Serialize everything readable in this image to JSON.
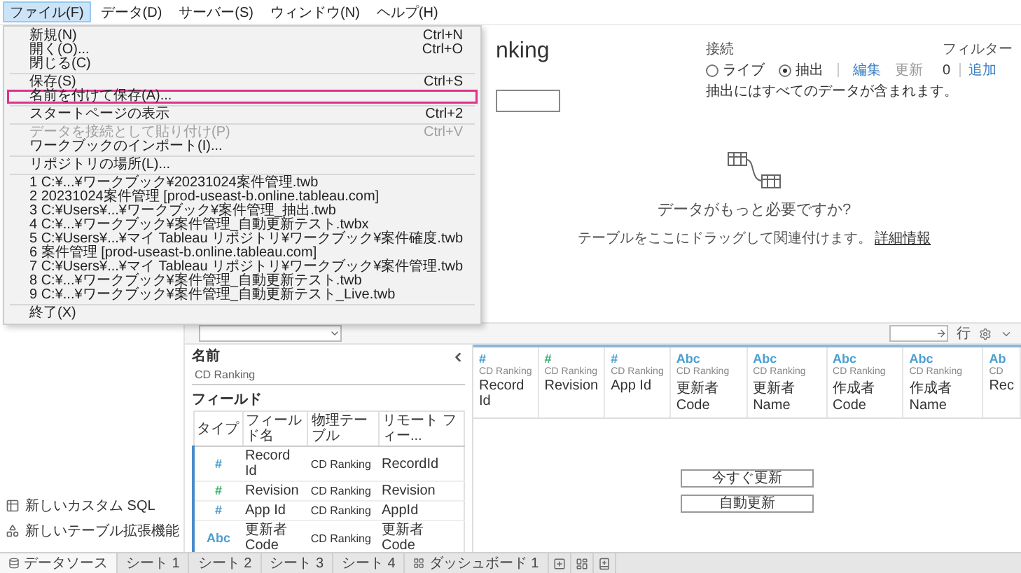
{
  "menubar": [
    {
      "label": "ファイル(F)",
      "selected": true
    },
    {
      "label": "データ(D)",
      "selected": false
    },
    {
      "label": "サーバー(S)",
      "selected": false
    },
    {
      "label": "ウィンドウ(N)",
      "selected": false
    },
    {
      "label": "ヘルプ(H)",
      "selected": false
    }
  ],
  "file_menu": [
    {
      "kind": "item",
      "label": "新規(N)",
      "shortcut": "Ctrl+N",
      "disabled": false,
      "highlighted": false
    },
    {
      "kind": "item",
      "label": "開く(O)...",
      "shortcut": "Ctrl+O",
      "disabled": false,
      "highlighted": false
    },
    {
      "kind": "item",
      "label": "閉じる(C)",
      "disabled": false,
      "highlighted": false
    },
    {
      "kind": "separator"
    },
    {
      "kind": "item",
      "label": "保存(S)",
      "shortcut": "Ctrl+S",
      "disabled": false,
      "highlighted": false
    },
    {
      "kind": "item",
      "label": "名前を付けて保存(A)...",
      "disabled": false,
      "highlighted": true
    },
    {
      "kind": "separator"
    },
    {
      "kind": "item",
      "label": "スタートページの表示",
      "shortcut": "Ctrl+2",
      "disabled": false,
      "highlighted": false
    },
    {
      "kind": "separator"
    },
    {
      "kind": "item",
      "label": "データを接続として貼り付け(P)",
      "shortcut": "Ctrl+V",
      "disabled": true,
      "highlighted": false
    },
    {
      "kind": "item",
      "label": "ワークブックのインポート(I)...",
      "disabled": false,
      "highlighted": false
    },
    {
      "kind": "separator"
    },
    {
      "kind": "item",
      "label": "リポジトリの場所(L)...",
      "disabled": false,
      "highlighted": false
    },
    {
      "kind": "separator"
    },
    {
      "kind": "item",
      "label": "1 C:¥...¥ワークブック¥20231024案件管理.twb",
      "disabled": false,
      "highlighted": false
    },
    {
      "kind": "item",
      "label": "2 20231024案件管理 [prod-useast-b.online.tableau.com]",
      "disabled": false,
      "highlighted": false
    },
    {
      "kind": "item",
      "label": "3 C:¥Users¥...¥ワークブック¥案件管理_抽出.twb",
      "disabled": false,
      "highlighted": false
    },
    {
      "kind": "item",
      "label": "4 C:¥...¥ワークブック¥案件管理_自動更新テスト.twbx",
      "disabled": false,
      "highlighted": false
    },
    {
      "kind": "item",
      "label": "5 C:¥Users¥...¥マイ Tableau リポジトリ¥ワークブック¥案件確度.twb",
      "disabled": false,
      "highlighted": false
    },
    {
      "kind": "item",
      "label": "6 案件管理 [prod-useast-b.online.tableau.com]",
      "disabled": false,
      "highlighted": false
    },
    {
      "kind": "item",
      "label": "7 C:¥Users¥...¥マイ Tableau リポジトリ¥ワークブック¥案件管理.twb",
      "disabled": false,
      "highlighted": false
    },
    {
      "kind": "item",
      "label": "8 C:¥...¥ワークブック¥案件管理_自動更新テスト.twb",
      "disabled": false,
      "highlighted": false
    },
    {
      "kind": "item",
      "label": "9 C:¥...¥ワークブック¥案件管理_自動更新テスト_Live.twb",
      "disabled": false,
      "highlighted": false
    },
    {
      "kind": "separator"
    },
    {
      "kind": "item",
      "label": "終了(X)",
      "disabled": false,
      "highlighted": false
    }
  ],
  "datasource": {
    "title": "nking"
  },
  "connection": {
    "label": "接続",
    "options": [
      {
        "label": "ライブ",
        "selected": false
      },
      {
        "label": "抽出",
        "selected": true
      }
    ],
    "actions": [
      {
        "label": "編集",
        "disabled": false
      },
      {
        "label": "更新",
        "disabled": true
      }
    ],
    "note": "抽出にはすべてのデータが含まれます。"
  },
  "filters": {
    "label": "フィルター",
    "count": "0",
    "add": "追加"
  },
  "canvas": {
    "heading": "データがもっと必要ですか?",
    "hint": "テーブルをここにドラッグして関連付けます。",
    "link": "詳細情報"
  },
  "toolbar": {
    "rows_label": "行"
  },
  "left_pane": {
    "items": [
      {
        "kind": "sql",
        "label": "新しいカスタム SQL"
      },
      {
        "kind": "extension",
        "label": "新しいテーブル拡張機能"
      }
    ]
  },
  "field_panel": {
    "name_label": "名前",
    "name_value": "CD Ranking",
    "fields_label": "フィールド",
    "columns": [
      "タイプ",
      "フィールド名",
      "物理テーブル",
      "リモート フィー..."
    ],
    "rows": [
      {
        "type": "#",
        "color": "#4a9fd0",
        "name": "Record Id",
        "table": "CD Ranking",
        "remote": "RecordId"
      },
      {
        "type": "#",
        "color": "#3cb371",
        "name": "Revision",
        "table": "CD Ranking",
        "remote": "Revision"
      },
      {
        "type": "#",
        "color": "#4a9fd0",
        "name": "App Id",
        "table": "CD Ranking",
        "remote": "AppId"
      },
      {
        "type": "Abc",
        "color": "#4a9fd0",
        "name": "更新者 Code",
        "table": "CD Ranking",
        "remote": "更新者 Code"
      }
    ]
  },
  "grid": {
    "columns": [
      {
        "type": "#",
        "color": "#4a9fd0",
        "source": "CD Ranking",
        "name": "Record Id"
      },
      {
        "type": "#",
        "color": "#3cb371",
        "source": "CD Ranking",
        "name": "Revision"
      },
      {
        "type": "#",
        "color": "#4a9fd0",
        "source": "CD Ranking",
        "name": "App Id"
      },
      {
        "type": "Abc",
        "color": "#4a9fd0",
        "source": "CD Ranking",
        "name": "更新者 Code"
      },
      {
        "type": "Abc",
        "color": "#4a9fd0",
        "source": "CD Ranking",
        "name": "更新者 Name"
      },
      {
        "type": "Abc",
        "color": "#4a9fd0",
        "source": "CD Ranking",
        "name": "作成者 Code"
      },
      {
        "type": "Abc",
        "color": "#4a9fd0",
        "source": "CD Ranking",
        "name": "作成者 Name"
      },
      {
        "type": "Ab",
        "color": "#4a9fd0",
        "source": "CD",
        "name": "Rec"
      }
    ],
    "buttons": [
      "今すぐ更新",
      "自動更新"
    ]
  },
  "tabs": [
    {
      "kind": "datasource",
      "label": "データソース",
      "selected": true
    },
    {
      "kind": "sheet",
      "label": "シート 1",
      "selected": false
    },
    {
      "kind": "sheet",
      "label": "シート 2",
      "selected": false
    },
    {
      "kind": "sheet",
      "label": "シート 3",
      "selected": false
    },
    {
      "kind": "sheet",
      "label": "シート 4",
      "selected": false
    },
    {
      "kind": "dashboard",
      "label": "ダッシュボード 1",
      "selected": false
    }
  ]
}
